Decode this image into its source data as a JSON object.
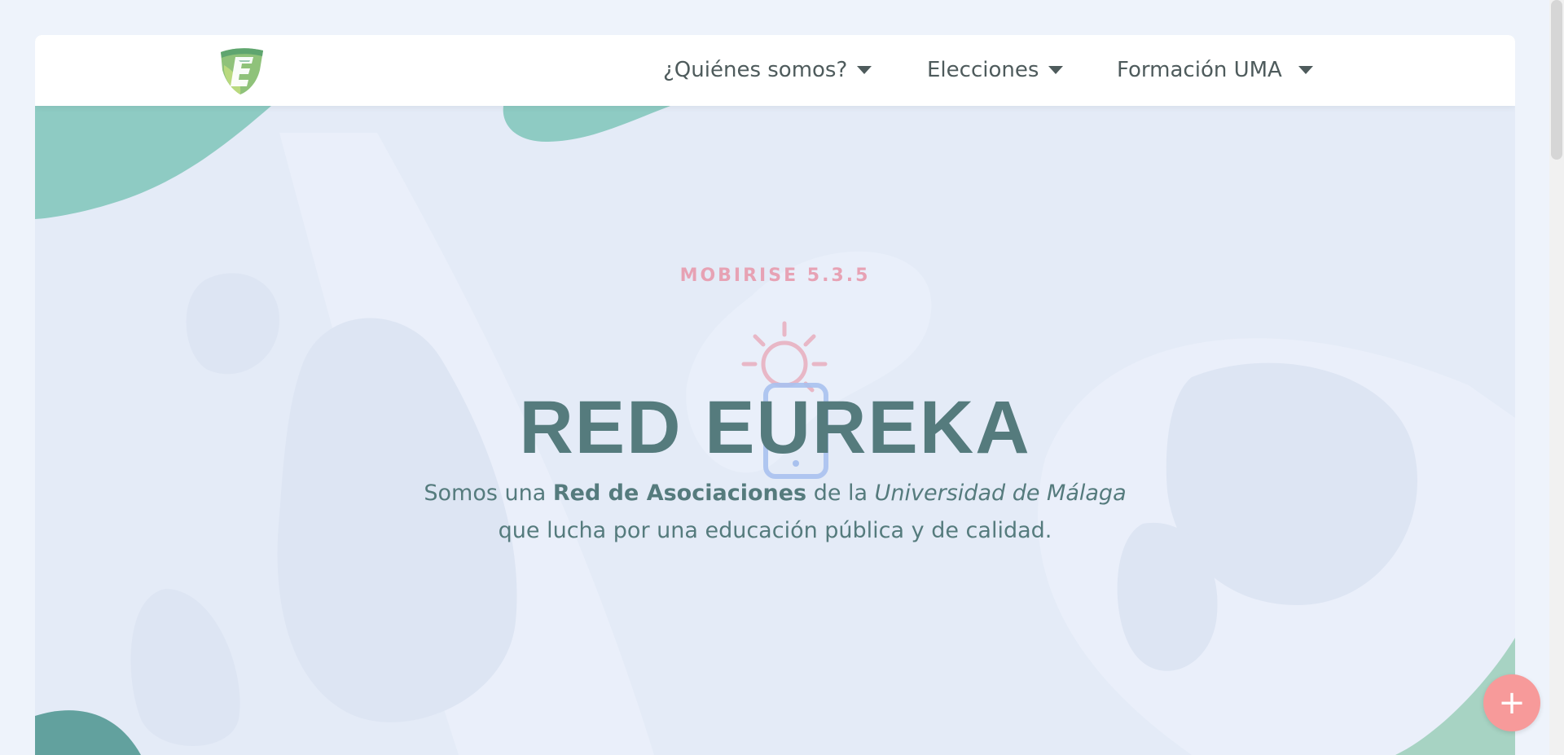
{
  "nav": {
    "logo_icon": "eureka-shield-logo",
    "items": [
      {
        "label": "¿Quiénes somos?",
        "icon": "caret-down-icon"
      },
      {
        "label": "Elecciones",
        "icon": "caret-down-icon"
      },
      {
        "label": "Formación UMA",
        "icon": "caret-down-icon"
      }
    ]
  },
  "hero": {
    "tag": "MOBIRISE  5.3.5",
    "icon": "lightbulb-phone-icon",
    "title": "RED EUREKA",
    "subtitle": {
      "part1": "Somos una ",
      "bold": "Red de Asociaciones",
      "part2": " de la ",
      "italic": "Universidad de Málaga",
      "line2": "que lucha por una educación pública y de calidad."
    }
  },
  "fab": {
    "label": "+",
    "icon": "plus-icon"
  },
  "colors": {
    "page_bg": "#eef3fb",
    "hero_bg": "#e4ebf7",
    "teal_blob": "#8ecbc3",
    "heading": "#557b7d",
    "tag": "#e7a2b4",
    "fab": "#f79a9a",
    "nav_text": "#4e5b5c"
  }
}
